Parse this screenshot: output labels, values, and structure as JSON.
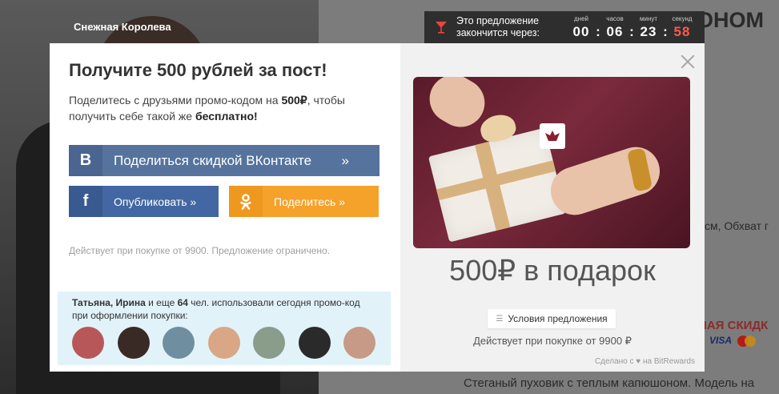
{
  "background": {
    "brand": "Снежная Королева",
    "title_fragment": "ОНОМ",
    "text_fragment": "см, Обхват г",
    "sale_fragment": "НАЯ СКИДК",
    "payment_visa": "VISA",
    "description_fragment": "Стеганый пуховик с теплым капюшоном. Модель на"
  },
  "timer": {
    "text": "Это предложение закончится через:",
    "units": [
      {
        "label": "дней",
        "value": "00"
      },
      {
        "label": "часов",
        "value": "06"
      },
      {
        "label": "минут",
        "value": "23"
      },
      {
        "label": "секунд",
        "value": "58"
      }
    ],
    "seconds_color": "#ff5a4a"
  },
  "modal": {
    "headline": "Получите 500 рублей за пост!",
    "lead_part1": "Поделитесь с друзьями промо-кодом на ",
    "lead_amount": "500₽",
    "lead_part2": ", чтобы получить себе такой же ",
    "lead_free": "бесплатно!",
    "vk_button": {
      "icon": "В",
      "label": "Поделиться скидкой ВКонтакте",
      "arrow": "»",
      "color": "#55739c"
    },
    "fb_button": {
      "icon": "f",
      "label": "Опубликовать »",
      "color": "#4267a2"
    },
    "ok_button": {
      "label": "Поделитесь »",
      "color": "#f4a22a"
    },
    "disclaimer": "Действует при покупке от 9900. Предложение ограничено.",
    "social_proof": {
      "names": "Татьяна, Ирина",
      "middle": " и еще ",
      "count": "64",
      "rest": " чел. использовали сегодня промо-код при оформлении покупки:"
    },
    "avatars": [
      {
        "name": "avatar-1",
        "color": "#b8575a"
      },
      {
        "name": "avatar-2",
        "color": "#3a2a26"
      },
      {
        "name": "avatar-3",
        "color": "#6f8fa0"
      },
      {
        "name": "avatar-4",
        "color": "#d9a785"
      },
      {
        "name": "avatar-5",
        "color": "#8a9c8a"
      },
      {
        "name": "avatar-6",
        "color": "#2a2a2a"
      },
      {
        "name": "avatar-7",
        "color": "#c69a86"
      }
    ],
    "gift_caption": "500₽ в подарок",
    "terms_button": "Условия предложения",
    "valid_text": "Действует при покупке от 9900 ₽",
    "made_by_prefix": "Сделано с",
    "made_by_suffix": "на BitRewards"
  }
}
